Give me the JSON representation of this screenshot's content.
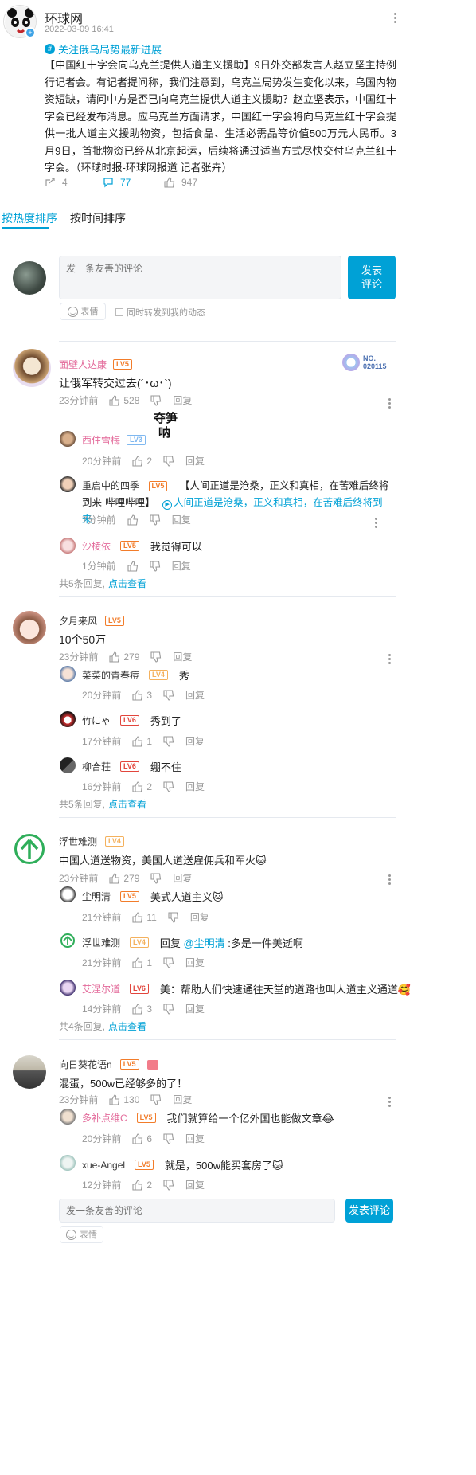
{
  "post": {
    "author": "环球网",
    "time": "2022-03-09 16:41",
    "topic": "关注俄乌局势最新进展",
    "body": "【中国红十字会向乌克兰提供人道主义援助】9日外交部发言人赵立坚主持例行记者会。有记者提问称，我们注意到，乌克兰局势发生变化以来，乌国内物资短缺，请问中方是否已向乌克兰提供人道主义援助？赵立坚表示，中国红十字会已经发布消息。应乌克兰方面请求，中国红十字会将向乌克兰红十字会提供一批人道主义援助物资，包括食品、生活必需品等价值500万元人民币。3月9日，首批物资已经从北京起运，后续将通过适当方式尽快交付乌克兰红十字会。（环球时报-环球网报道 记者张卉）",
    "forward_count": "4",
    "comment_count": "77",
    "like_count": "947"
  },
  "tabs": {
    "hot": "按热度排序",
    "time": "按时间排序"
  },
  "composer": {
    "placeholder": "发一条友善的评论",
    "submit_line1": "发表",
    "submit_line2": "评论",
    "emoji_label": "表情",
    "sync_label": "同时转发到我的动态"
  },
  "bottom_composer": {
    "placeholder": "发一条友善的评论",
    "submit": "发表评论",
    "emoji_label": "表情"
  },
  "labels": {
    "reply": "回复",
    "view_more": "点击查看"
  },
  "fan_badge": {
    "line1": "NO.",
    "line2": "020115"
  },
  "sticker": {
    "line1": "夺笋",
    "line2": "呐"
  },
  "comments": [
    {
      "user": "面壁人达康",
      "level": "LV5",
      "text": "让俄军转交过去(´･ω･`)",
      "time": "23分钟前",
      "likes": "528",
      "replies": [
        {
          "user": "西住雪梅",
          "level": "LV3",
          "text": "",
          "time": "20分钟前",
          "likes": "2"
        },
        {
          "user": "重启中的四季",
          "level": "LV5",
          "text": "【人间正道是沧桑，正义和真相，在苦难后终将到来-哔哩哔哩】",
          "link": "人间正道是沧桑，正义和真相，在苦难后终将到来",
          "time": "7分钟前",
          "likes": ""
        },
        {
          "user": "沙棱依",
          "level": "LV5",
          "text": "我觉得可以",
          "time": "1分钟前",
          "likes": ""
        }
      ],
      "reply_summary": "共5条回复,"
    },
    {
      "user": "夕月来风",
      "level": "LV5",
      "text": "10个50万",
      "time": "23分钟前",
      "likes": "279",
      "replies": [
        {
          "user": "菜菜的青春痘",
          "level": "LV4",
          "text": "秀",
          "time": "20分钟前",
          "likes": "3"
        },
        {
          "user": "竹にゃ",
          "level": "LV6",
          "text": "秀到了",
          "time": "17分钟前",
          "likes": "1"
        },
        {
          "user": "柳合荘",
          "level": "LV6",
          "text": "绷不住",
          "time": "16分钟前",
          "likes": "2"
        }
      ],
      "reply_summary": "共5条回复,"
    },
    {
      "user": "浮世难测",
      "level": "LV4",
      "text": "中国人道送物资，美国人道送雇佣兵和军火🐱",
      "time": "23分钟前",
      "likes": "279",
      "replies": [
        {
          "user": "尘明清",
          "level": "LV5",
          "text": "美式人道主义🐱",
          "time": "21分钟前",
          "likes": "11"
        },
        {
          "user": "浮世难测",
          "level": "LV4",
          "text_prefix": "回复 ",
          "mention": "@尘明清",
          "text": " :多是一件美逝啊",
          "time": "21分钟前",
          "likes": "1"
        },
        {
          "user": "艾涅尔道",
          "level": "LV6",
          "text": "美：帮助人们快速通往天堂的道路也叫人道主义通道🥰",
          "time": "14分钟前",
          "likes": "3"
        }
      ],
      "reply_summary": "共4条回复,"
    },
    {
      "user": "向日葵花语n",
      "level": "LV5",
      "text": "混蛋，500w已经够多的了！",
      "time": "23分钟前",
      "likes": "130",
      "replies": [
        {
          "user": "多补点维C",
          "level": "LV5",
          "text": "我们就算给一个亿外国也能做文章😂",
          "time": "20分钟前",
          "likes": "6"
        },
        {
          "user": "xue-Angel",
          "level": "LV5",
          "text": "就是，500w能买套房了🐱",
          "time": "12分钟前",
          "likes": "2"
        }
      ]
    }
  ],
  "colors": {
    "accent": "#00a1d6",
    "level5": "#f27c2a",
    "level6": "#e2453c",
    "pink_name": "#e36a9a"
  }
}
